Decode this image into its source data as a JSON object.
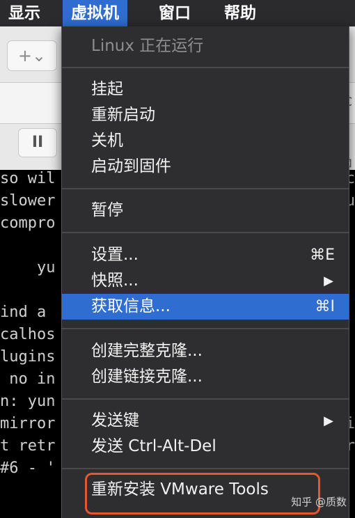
{
  "menubar": {
    "items": [
      "显示",
      "虚拟机",
      "窗口",
      "帮助"
    ]
  },
  "toolbar": {
    "add_button": "+⌄",
    "pause_button": "II",
    "right_fragment_top": "C",
    "right_fragment_bottom": "⊠"
  },
  "terminal": {
    "left_lines": [
      "so wil",
      "slower",
      "compro",
      "    yu",
      "ind a",
      "calhos",
      "lugins",
      " no in",
      "n: yun",
      "mirror",
      "t retr",
      "#6 - '"
    ],
    "right_lines": [
      "c",
      "u",
      "",
      "",
      "",
      "",
      "",
      "",
      "",
      "i",
      "r",
      ""
    ]
  },
  "menu": {
    "status": "Linux 正在运行",
    "group1": [
      "挂起",
      "重新启动",
      "关机",
      "启动到固件"
    ],
    "pause": "暂停",
    "settings": "设置...",
    "settings_shortcut": "⌘E",
    "snapshots": "快照...",
    "get_info": "获取信息...",
    "get_info_shortcut": "⌘I",
    "full_clone": "创建完整克隆...",
    "linked_clone": "创建链接克隆...",
    "send_key": "发送键",
    "send_cad": "发送 Ctrl-Alt-Del",
    "reinstall_tools": "重新安装 VMware Tools"
  },
  "watermark": "知乎 @质数"
}
